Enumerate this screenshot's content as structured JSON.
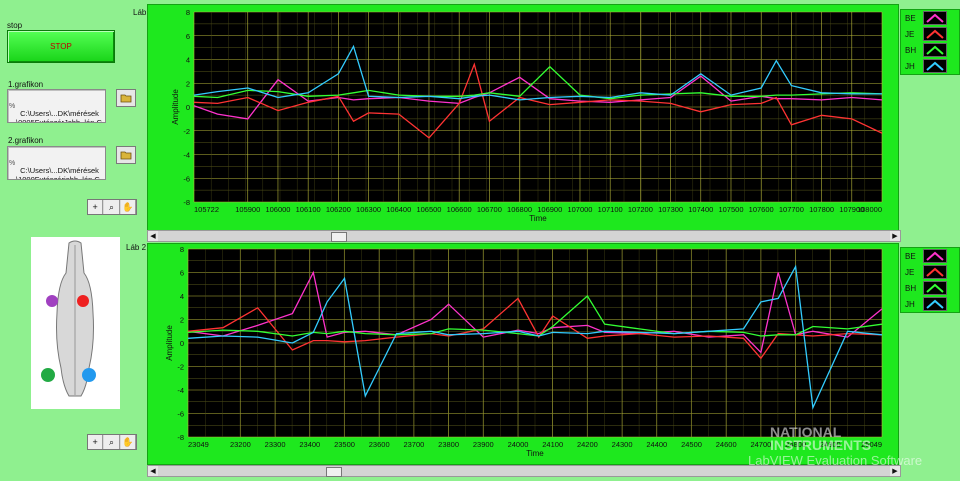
{
  "stop": {
    "label": "stop",
    "button": "STOP"
  },
  "file1": {
    "label": "1.grafikon",
    "path": "C:\\Users\\...DK\\mérések\\0005FutószárJobb_lép.CSV"
  },
  "file2": {
    "label": "2.grafikon",
    "path": "C:\\Users\\...DK\\mérések\\1000Futószárjobb_lép.CSV"
  },
  "graph1": {
    "title": "Láb",
    "ylabel": "Amplitude",
    "xlabel": "Time",
    "yticks": [
      "8",
      "6",
      "4",
      "2",
      "0",
      "-2",
      "-4",
      "-6",
      "-8"
    ],
    "xticks": [
      "105722",
      "105900",
      "106000",
      "106100",
      "106200",
      "106300",
      "106400",
      "106500",
      "106600",
      "106700",
      "106800",
      "106900",
      "107000",
      "107100",
      "107200",
      "107300",
      "107400",
      "107500",
      "107600",
      "107700",
      "107800",
      "107900",
      "108000"
    ]
  },
  "graph2": {
    "title": "Láb 2",
    "ylabel": "Amplitude",
    "xlabel": "Time",
    "yticks": [
      "8",
      "6",
      "4",
      "2",
      "0",
      "-2",
      "-4",
      "-6",
      "-8"
    ],
    "xticks": [
      "23049",
      "23200",
      "23300",
      "23400",
      "23500",
      "23600",
      "23700",
      "23800",
      "23900",
      "24000",
      "24100",
      "24200",
      "24300",
      "24400",
      "24500",
      "24600",
      "24700",
      "24800",
      "24900",
      "25049"
    ]
  },
  "legend": [
    {
      "name": "BE",
      "color": "#ff33cc"
    },
    {
      "name": "JE",
      "color": "#ff3333"
    },
    {
      "name": "BH",
      "color": "#33ff33"
    },
    {
      "name": "JH",
      "color": "#33ccff"
    }
  ],
  "chart_data": [
    {
      "type": "line",
      "title": "Láb",
      "xlabel": "Time",
      "ylabel": "Amplitude",
      "xlim": [
        105722,
        108000
      ],
      "ylim": [
        -8,
        8
      ],
      "grid": true,
      "legend": "right",
      "x": [
        105722,
        105800,
        105900,
        106000,
        106100,
        106200,
        106250,
        106300,
        106400,
        106500,
        106600,
        106650,
        106700,
        106800,
        106900,
        107000,
        107100,
        107200,
        107300,
        107400,
        107500,
        107600,
        107650,
        107700,
        107800,
        107900,
        108000
      ],
      "series": [
        {
          "name": "BE",
          "values": [
            0.1,
            -0.6,
            -1.0,
            2.3,
            0.5,
            0.8,
            0.6,
            0.7,
            0.8,
            0.5,
            0.3,
            0.8,
            1.2,
            2.5,
            0.7,
            0.5,
            0.4,
            0.6,
            0.8,
            2.6,
            0.5,
            0.9,
            0.7,
            0.7,
            0.6,
            0.8,
            0.6
          ]
        },
        {
          "name": "JE",
          "values": [
            0.4,
            0.3,
            0.8,
            -0.3,
            0.4,
            0.9,
            -1.2,
            -0.5,
            -0.6,
            -2.6,
            0.3,
            3.6,
            -1.2,
            0.8,
            0.2,
            0.4,
            0.6,
            0.5,
            0.3,
            -0.4,
            0.2,
            0.3,
            0.8,
            -1.5,
            -0.7,
            -1.0,
            -2.2
          ]
        },
        {
          "name": "BH",
          "values": [
            0.9,
            0.8,
            1.4,
            1.3,
            0.9,
            1.0,
            1.2,
            1.4,
            1.0,
            0.9,
            0.9,
            1.0,
            1.2,
            0.9,
            3.4,
            1.0,
            0.7,
            1.0,
            1.1,
            1.2,
            0.9,
            0.9,
            1.0,
            1.0,
            1.1,
            1.2,
            1.1
          ]
        },
        {
          "name": "JH",
          "values": [
            1.0,
            1.3,
            1.6,
            0.8,
            1.2,
            2.8,
            5.1,
            0.9,
            0.8,
            0.9,
            0.7,
            0.9,
            1.0,
            0.6,
            0.8,
            0.9,
            0.8,
            1.2,
            1.0,
            2.8,
            1.0,
            1.6,
            3.9,
            1.8,
            1.2,
            1.1,
            1.1
          ]
        }
      ]
    },
    {
      "type": "line",
      "title": "Láb 2",
      "xlabel": "Time",
      "ylabel": "Amplitude",
      "xlim": [
        23049,
        25049
      ],
      "ylim": [
        -8,
        8
      ],
      "grid": true,
      "legend": "right",
      "x": [
        23049,
        23150,
        23250,
        23350,
        23410,
        23450,
        23500,
        23560,
        23650,
        23750,
        23800,
        23900,
        24000,
        24060,
        24100,
        24200,
        24250,
        24350,
        24450,
        24550,
        24650,
        24700,
        24750,
        24800,
        24850,
        24950,
        25049
      ],
      "series": [
        {
          "name": "BE",
          "values": [
            1.0,
            0.6,
            1.5,
            2.5,
            6.0,
            0.5,
            0.9,
            1.0,
            0.7,
            2.0,
            3.3,
            0.5,
            1.1,
            0.8,
            1.3,
            1.5,
            0.9,
            0.8,
            1.0,
            0.5,
            0.7,
            -0.8,
            6.0,
            0.7,
            1.0,
            0.5,
            2.9
          ]
        },
        {
          "name": "JE",
          "values": [
            1.0,
            1.3,
            3.0,
            -0.6,
            0.2,
            0.2,
            0.1,
            0.2,
            0.5,
            0.8,
            0.6,
            1.2,
            3.8,
            0.5,
            2.3,
            0.4,
            0.6,
            0.8,
            0.5,
            0.6,
            0.4,
            -1.3,
            0.8,
            0.7,
            0.6,
            0.8,
            0.7
          ]
        },
        {
          "name": "BH",
          "values": [
            0.9,
            1.1,
            1.0,
            0.6,
            0.9,
            0.8,
            1.0,
            0.8,
            0.7,
            0.8,
            1.2,
            1.1,
            0.8,
            0.6,
            1.4,
            4.0,
            1.6,
            1.2,
            0.8,
            1.0,
            0.9,
            0.6,
            0.7,
            0.7,
            1.4,
            1.2,
            1.6
          ]
        },
        {
          "name": "JH",
          "values": [
            0.4,
            0.6,
            0.5,
            0.0,
            0.9,
            3.5,
            5.5,
            -4.5,
            0.8,
            1.0,
            0.7,
            0.8,
            1.0,
            0.6,
            0.9,
            0.8,
            1.0,
            0.9,
            0.8,
            1.0,
            1.2,
            3.5,
            3.8,
            6.5,
            -5.5,
            1.0,
            0.7
          ]
        }
      ]
    }
  ],
  "image": {
    "dots": [
      {
        "color": "#a040c0"
      },
      {
        "color": "#ee2020"
      },
      {
        "color": "#22aa44"
      },
      {
        "color": "#2299ee"
      }
    ]
  },
  "watermark": {
    "line1": "NATIONAL",
    "line2": "INSTRUMENTS",
    "line3": "LabVIEW  Evaluation Software"
  }
}
